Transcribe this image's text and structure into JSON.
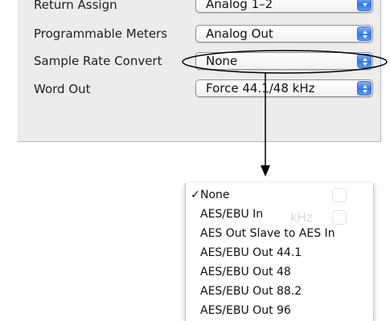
{
  "settings": {
    "rows": [
      {
        "label": "Return Assign",
        "value": "Analog 1–2"
      },
      {
        "label": "Programmable Meters",
        "value": "Analog Out"
      },
      {
        "label": "Sample Rate Convert",
        "value": "None"
      },
      {
        "label": "Word Out",
        "value": "Force 44.1/48 kHz"
      }
    ]
  },
  "menu": {
    "selected_mark": "✓",
    "items": [
      "None",
      "AES/EBU In",
      "AES Out Slave to AES In",
      "AES/EBU Out 44.1",
      "AES/EBU Out 48",
      "AES/EBU Out 88.2",
      "AES/EBU Out 96"
    ],
    "ghost_text": "kHz"
  },
  "colors": {
    "panel_bg": "#ececec",
    "stepper_blue": "#2f78e6",
    "callout_line": "#000000"
  }
}
